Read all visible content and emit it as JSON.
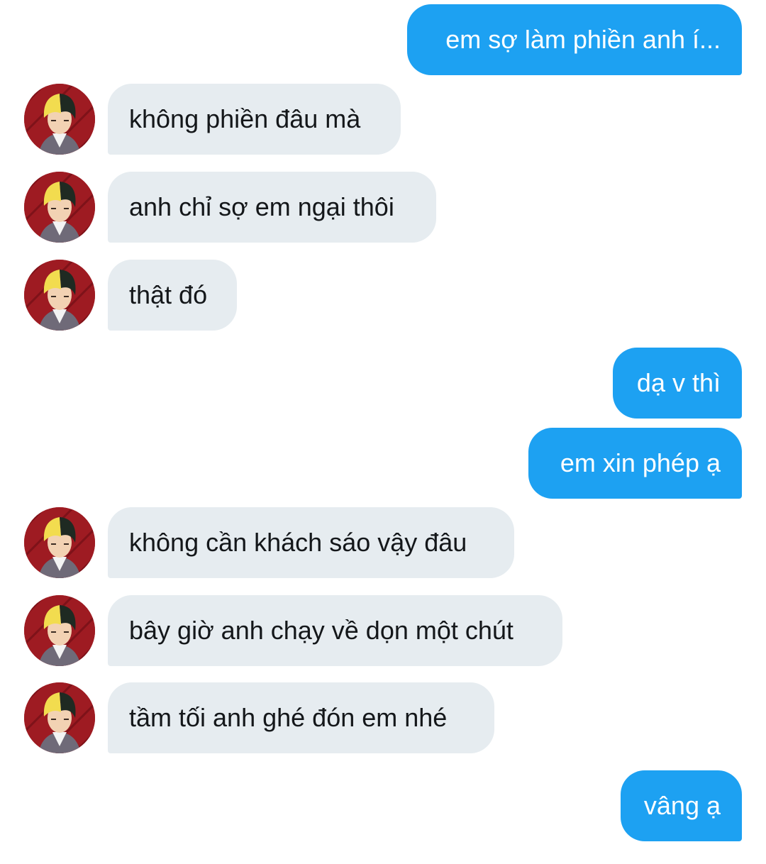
{
  "messages": [
    {
      "side": "out",
      "text": "em sợ làm phiền anh í..."
    },
    {
      "side": "in",
      "text": "không phiền đâu mà"
    },
    {
      "side": "in",
      "text": "anh chỉ sợ em ngại thôi"
    },
    {
      "side": "in",
      "text": "thật đó"
    },
    {
      "side": "out",
      "text": "dạ v thì"
    },
    {
      "side": "out",
      "text": "em xin phép ạ"
    },
    {
      "side": "in",
      "text": "không cần khách sáo vậy đâu"
    },
    {
      "side": "in",
      "text": "bây giờ anh chạy về dọn một chút"
    },
    {
      "side": "in",
      "text": "tầm tối anh ghé đón em nhé"
    },
    {
      "side": "out",
      "text": "vâng ạ"
    }
  ],
  "colors": {
    "outgoing_bubble": "#1da1f2",
    "outgoing_text": "#ffffff",
    "incoming_bubble": "#e6ecf0",
    "incoming_text": "#14171a",
    "background": "#ffffff"
  },
  "avatar": {
    "icon": "anime-character-avatar"
  }
}
